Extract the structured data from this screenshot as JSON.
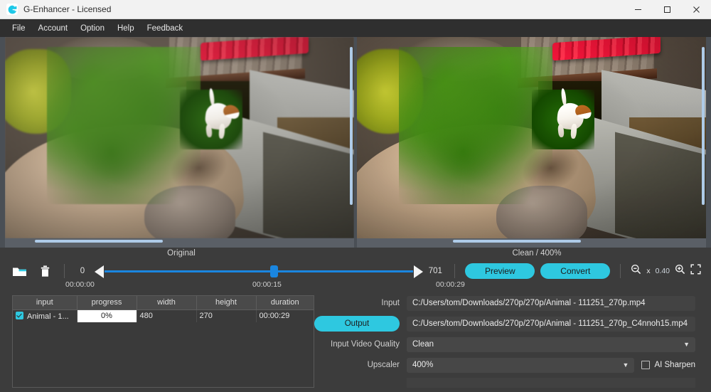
{
  "window": {
    "title": "G-Enhancer - Licensed",
    "logo_icon": "g-logo-icon",
    "minimize_icon": "minimize-icon",
    "maximize_icon": "maximize-icon",
    "close_icon": "close-icon"
  },
  "menubar": {
    "items": [
      {
        "label": "File"
      },
      {
        "label": "Account"
      },
      {
        "label": "Option"
      },
      {
        "label": "Help"
      },
      {
        "label": "Feedback"
      }
    ]
  },
  "previews": {
    "left": {
      "label": "Original"
    },
    "right": {
      "label": "Clean / 400%"
    }
  },
  "toolbar": {
    "open_folder_icon": "folder-icon",
    "delete_icon": "trash-icon",
    "range_start": "0",
    "range_end": "701",
    "time_start": "00:00:00",
    "time_current": "00:00:15",
    "time_end": "00:00:29",
    "preview_label": "Preview",
    "convert_label": "Convert",
    "zoom_out_icon": "zoom-out-icon",
    "zoom_in_icon": "zoom-in-icon",
    "fullscreen_icon": "fullscreen-icon",
    "zoom_multiplier": "x",
    "zoom_value": "0.40"
  },
  "filelist": {
    "columns": [
      "input",
      "progress",
      "width",
      "height",
      "duration"
    ],
    "rows": [
      {
        "checked": true,
        "input": "Animal - 1...",
        "progress": "0%",
        "width": "480",
        "height": "270",
        "duration": "00:00:29"
      }
    ]
  },
  "settings": {
    "input_label": "Input",
    "input_value": "C:/Users/tom/Downloads/270p/270p/Animal - 111251_270p.mp4",
    "output_label": "Output",
    "output_value": "C:/Users/tom/Downloads/270p/270p/Animal - 111251_270p_C4nnoh15.mp4",
    "quality_label": "Input Video Quality",
    "quality_value": "Clean",
    "upscaler_label": "Upscaler",
    "upscaler_value": "400%",
    "ai_sharpen_label": "AI Sharpen",
    "ai_sharpen_checked": false
  },
  "colors": {
    "accent_cyan": "#2ec8e0",
    "slider_blue": "#1a86e0",
    "window_bg": "#3c3c3c",
    "titlebar_bg": "#f2f2f2"
  }
}
